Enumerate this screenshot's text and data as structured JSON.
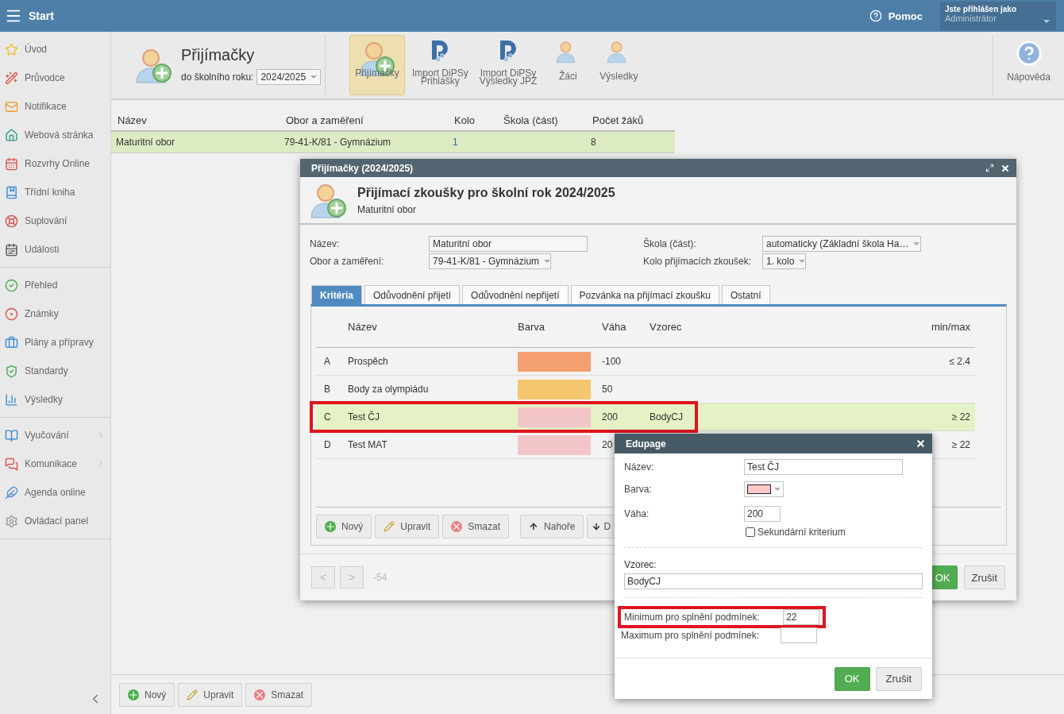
{
  "topbar": {
    "title": "Start",
    "help": "Pomoc",
    "user_caption": "Jste přihlášen jako",
    "user_name": "Administrátor"
  },
  "sidebar": {
    "groups": [
      [
        {
          "label": "Úvod",
          "submenu": false
        },
        {
          "label": "Průvodce",
          "submenu": false
        },
        {
          "label": "Notifikace",
          "submenu": false
        },
        {
          "label": "Webová stránka",
          "submenu": false
        },
        {
          "label": "Rozvrhy Online",
          "submenu": false
        },
        {
          "label": "Třídní kniha",
          "submenu": false
        },
        {
          "label": "Suplování",
          "submenu": false
        },
        {
          "label": "Události",
          "submenu": false
        }
      ],
      [
        {
          "label": "Přehled",
          "submenu": false
        },
        {
          "label": "Známky",
          "submenu": false
        },
        {
          "label": "Plány a přípravy",
          "submenu": false
        },
        {
          "label": "Standardy",
          "submenu": false
        },
        {
          "label": "Výsledky",
          "submenu": false
        }
      ],
      [
        {
          "label": "Vyučování",
          "submenu": true
        },
        {
          "label": "Komunikace",
          "submenu": true
        },
        {
          "label": "Agenda online",
          "submenu": false
        },
        {
          "label": "Ovládací panel",
          "submenu": false
        }
      ]
    ]
  },
  "header": {
    "title": "Přijímačky",
    "year_label": "do školního roku:",
    "year": "2024/2025",
    "toolbar": [
      {
        "kind": "person-plus",
        "label": "Přijímačky",
        "selected": true
      },
      {
        "kind": "dipsy",
        "label": "Import DiPSy\nPrihlášky",
        "selected": false
      },
      {
        "kind": "dipsy",
        "label": "Import DiPSy\nVýsledky JPZ",
        "selected": false
      },
      {
        "kind": "person",
        "label": "Žáci",
        "selected": false
      },
      {
        "kind": "person",
        "label": "Výsledky",
        "selected": false
      }
    ],
    "help": "Nápověda"
  },
  "table": {
    "columns": [
      "Název",
      "Obor a zaměření",
      "Kolo",
      "Škola (část)",
      "Počet žáků"
    ],
    "rows": [
      {
        "cells": [
          "Maturitní obor",
          "79-41-K/81 - Gymnázium",
          "1",
          "",
          "8"
        ],
        "selected": true
      }
    ]
  },
  "actions": [
    "Nový",
    "Upravit",
    "Smazat"
  ],
  "dialog": {
    "title": "Přijímačky (2024/2025)",
    "heading": "Přijímací zkoušky pro školní rok 2024/2025",
    "subheading": "Maturitní obor",
    "fields": [
      {
        "label": "Název:",
        "value": "Maturitní obor",
        "kind": "text"
      },
      {
        "label": "Škola (část):",
        "value": "automaticky (Základní škola Ha…",
        "kind": "select"
      },
      {
        "label": "Obor a zaměření:",
        "value": "79-41-K/81 - Gymnázium",
        "kind": "select"
      },
      {
        "label": "Kolo přijímacích zkoušek:",
        "value": "1. kolo",
        "kind": "select"
      }
    ],
    "tabs": [
      {
        "label": "Kritéria",
        "selected": true
      },
      {
        "label": "Odůvodnění přijetí",
        "selected": false
      },
      {
        "label": "Odůvodnění nepřijetí",
        "selected": false
      },
      {
        "label": "Pozvánka na přijímací zkoušku",
        "selected": false
      },
      {
        "label": "Ostatní",
        "selected": false
      }
    ],
    "criteria": {
      "columns": [
        "Název",
        "Barva",
        "Váha",
        "Vzorec",
        "min/max"
      ],
      "rows": [
        {
          "letter": "A",
          "name": "Prospěch",
          "color": "#f4a070",
          "weight": "-100",
          "formula": "",
          "limit": "≤ 2.4",
          "selected": false,
          "highlighted": false
        },
        {
          "letter": "B",
          "name": "Body za olympiádu",
          "color": "#f5c66e",
          "weight": "50",
          "formula": "",
          "limit": "",
          "selected": false,
          "highlighted": false
        },
        {
          "letter": "C",
          "name": "Test ČJ",
          "color": "#f2c6c8",
          "weight": "200",
          "formula": "BodyCJ",
          "limit": "≥ 22",
          "selected": true,
          "highlighted": true
        },
        {
          "letter": "D",
          "name": "Test MAT",
          "color": "#f2c6c9",
          "weight": "20",
          "formula": "",
          "limit": "≥ 22",
          "selected": false,
          "highlighted": false
        }
      ]
    },
    "actions": [
      {
        "kind": "add",
        "label": "Nový"
      },
      {
        "kind": "edit",
        "label": "Upravit"
      },
      {
        "kind": "delete",
        "label": "Smazat"
      },
      {
        "kind": "up",
        "label": "Nahoře"
      },
      {
        "kind": "down",
        "label": "D"
      }
    ],
    "pager": {
      "prev": "<",
      "next": ">",
      "info": "-54"
    },
    "buttons": [
      {
        "kind": "primary",
        "label": "OK"
      },
      {
        "kind": "secondary",
        "label": "Zrušit"
      }
    ]
  },
  "edit_dialog": {
    "title": "Edupage",
    "name_label": "Název:",
    "name": "Test ČJ",
    "color_label": "Barva:",
    "color": "#ffc8c8",
    "weight_label": "Váha:",
    "weight": "200",
    "secondary": {
      "label": "Sekundární kriterium",
      "checked": false
    },
    "formula_label": "Vzorec:",
    "formula": "BodyCJ",
    "min_label": "Minimum pro splnění podmínek:",
    "min": "22",
    "min_highlighted": true,
    "max_label": "Maximum pro splnění podmínek:",
    "buttons": [
      {
        "kind": "primary",
        "label": "OK"
      },
      {
        "kind": "secondary",
        "label": "Zrušit"
      }
    ]
  }
}
